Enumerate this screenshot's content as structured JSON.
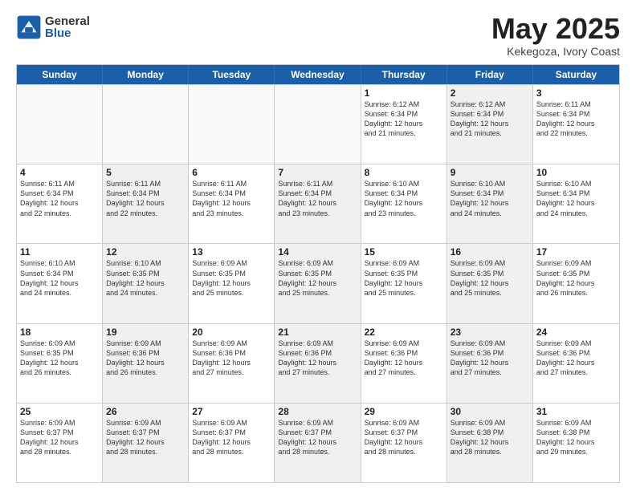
{
  "logo": {
    "general": "General",
    "blue": "Blue"
  },
  "title": {
    "month": "May 2025",
    "location": "Kekegoza, Ivory Coast"
  },
  "header_days": [
    "Sunday",
    "Monday",
    "Tuesday",
    "Wednesday",
    "Thursday",
    "Friday",
    "Saturday"
  ],
  "weeks": [
    [
      {
        "day": "",
        "info": "",
        "empty": true
      },
      {
        "day": "",
        "info": "",
        "empty": true
      },
      {
        "day": "",
        "info": "",
        "empty": true
      },
      {
        "day": "",
        "info": "",
        "empty": true
      },
      {
        "day": "1",
        "info": "Sunrise: 6:12 AM\nSunset: 6:34 PM\nDaylight: 12 hours\nand 21 minutes.",
        "empty": false
      },
      {
        "day": "2",
        "info": "Sunrise: 6:12 AM\nSunset: 6:34 PM\nDaylight: 12 hours\nand 21 minutes.",
        "empty": false,
        "shaded": true
      },
      {
        "day": "3",
        "info": "Sunrise: 6:11 AM\nSunset: 6:34 PM\nDaylight: 12 hours\nand 22 minutes.",
        "empty": false
      }
    ],
    [
      {
        "day": "4",
        "info": "Sunrise: 6:11 AM\nSunset: 6:34 PM\nDaylight: 12 hours\nand 22 minutes.",
        "empty": false
      },
      {
        "day": "5",
        "info": "Sunrise: 6:11 AM\nSunset: 6:34 PM\nDaylight: 12 hours\nand 22 minutes.",
        "empty": false,
        "shaded": true
      },
      {
        "day": "6",
        "info": "Sunrise: 6:11 AM\nSunset: 6:34 PM\nDaylight: 12 hours\nand 23 minutes.",
        "empty": false
      },
      {
        "day": "7",
        "info": "Sunrise: 6:11 AM\nSunset: 6:34 PM\nDaylight: 12 hours\nand 23 minutes.",
        "empty": false,
        "shaded": true
      },
      {
        "day": "8",
        "info": "Sunrise: 6:10 AM\nSunset: 6:34 PM\nDaylight: 12 hours\nand 23 minutes.",
        "empty": false
      },
      {
        "day": "9",
        "info": "Sunrise: 6:10 AM\nSunset: 6:34 PM\nDaylight: 12 hours\nand 24 minutes.",
        "empty": false,
        "shaded": true
      },
      {
        "day": "10",
        "info": "Sunrise: 6:10 AM\nSunset: 6:34 PM\nDaylight: 12 hours\nand 24 minutes.",
        "empty": false
      }
    ],
    [
      {
        "day": "11",
        "info": "Sunrise: 6:10 AM\nSunset: 6:34 PM\nDaylight: 12 hours\nand 24 minutes.",
        "empty": false
      },
      {
        "day": "12",
        "info": "Sunrise: 6:10 AM\nSunset: 6:35 PM\nDaylight: 12 hours\nand 24 minutes.",
        "empty": false,
        "shaded": true
      },
      {
        "day": "13",
        "info": "Sunrise: 6:09 AM\nSunset: 6:35 PM\nDaylight: 12 hours\nand 25 minutes.",
        "empty": false
      },
      {
        "day": "14",
        "info": "Sunrise: 6:09 AM\nSunset: 6:35 PM\nDaylight: 12 hours\nand 25 minutes.",
        "empty": false,
        "shaded": true
      },
      {
        "day": "15",
        "info": "Sunrise: 6:09 AM\nSunset: 6:35 PM\nDaylight: 12 hours\nand 25 minutes.",
        "empty": false
      },
      {
        "day": "16",
        "info": "Sunrise: 6:09 AM\nSunset: 6:35 PM\nDaylight: 12 hours\nand 25 minutes.",
        "empty": false,
        "shaded": true
      },
      {
        "day": "17",
        "info": "Sunrise: 6:09 AM\nSunset: 6:35 PM\nDaylight: 12 hours\nand 26 minutes.",
        "empty": false
      }
    ],
    [
      {
        "day": "18",
        "info": "Sunrise: 6:09 AM\nSunset: 6:35 PM\nDaylight: 12 hours\nand 26 minutes.",
        "empty": false
      },
      {
        "day": "19",
        "info": "Sunrise: 6:09 AM\nSunset: 6:36 PM\nDaylight: 12 hours\nand 26 minutes.",
        "empty": false,
        "shaded": true
      },
      {
        "day": "20",
        "info": "Sunrise: 6:09 AM\nSunset: 6:36 PM\nDaylight: 12 hours\nand 27 minutes.",
        "empty": false
      },
      {
        "day": "21",
        "info": "Sunrise: 6:09 AM\nSunset: 6:36 PM\nDaylight: 12 hours\nand 27 minutes.",
        "empty": false,
        "shaded": true
      },
      {
        "day": "22",
        "info": "Sunrise: 6:09 AM\nSunset: 6:36 PM\nDaylight: 12 hours\nand 27 minutes.",
        "empty": false
      },
      {
        "day": "23",
        "info": "Sunrise: 6:09 AM\nSunset: 6:36 PM\nDaylight: 12 hours\nand 27 minutes.",
        "empty": false,
        "shaded": true
      },
      {
        "day": "24",
        "info": "Sunrise: 6:09 AM\nSunset: 6:36 PM\nDaylight: 12 hours\nand 27 minutes.",
        "empty": false
      }
    ],
    [
      {
        "day": "25",
        "info": "Sunrise: 6:09 AM\nSunset: 6:37 PM\nDaylight: 12 hours\nand 28 minutes.",
        "empty": false
      },
      {
        "day": "26",
        "info": "Sunrise: 6:09 AM\nSunset: 6:37 PM\nDaylight: 12 hours\nand 28 minutes.",
        "empty": false,
        "shaded": true
      },
      {
        "day": "27",
        "info": "Sunrise: 6:09 AM\nSunset: 6:37 PM\nDaylight: 12 hours\nand 28 minutes.",
        "empty": false
      },
      {
        "day": "28",
        "info": "Sunrise: 6:09 AM\nSunset: 6:37 PM\nDaylight: 12 hours\nand 28 minutes.",
        "empty": false,
        "shaded": true
      },
      {
        "day": "29",
        "info": "Sunrise: 6:09 AM\nSunset: 6:37 PM\nDaylight: 12 hours\nand 28 minutes.",
        "empty": false
      },
      {
        "day": "30",
        "info": "Sunrise: 6:09 AM\nSunset: 6:38 PM\nDaylight: 12 hours\nand 28 minutes.",
        "empty": false,
        "shaded": true
      },
      {
        "day": "31",
        "info": "Sunrise: 6:09 AM\nSunset: 6:38 PM\nDaylight: 12 hours\nand 29 minutes.",
        "empty": false
      }
    ]
  ]
}
